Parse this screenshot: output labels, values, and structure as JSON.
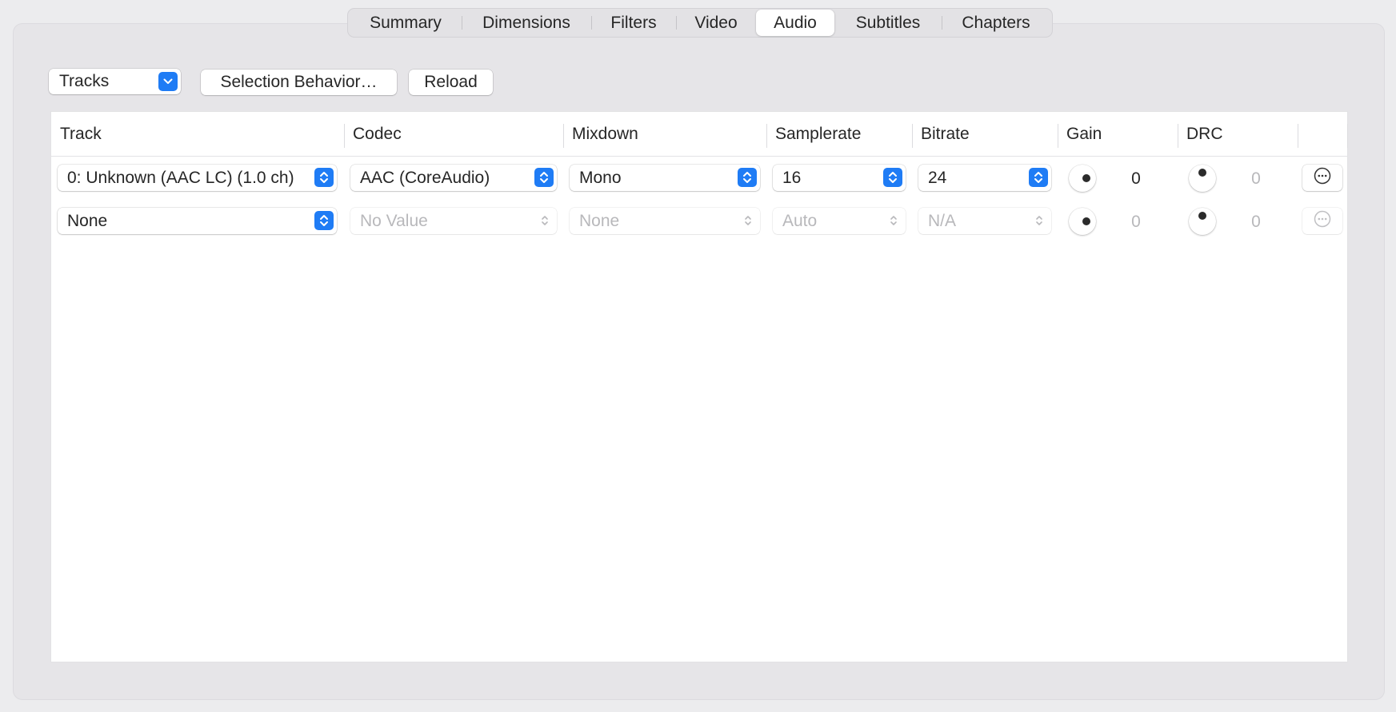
{
  "tabs": [
    {
      "label": "Summary",
      "active": false
    },
    {
      "label": "Dimensions",
      "active": false
    },
    {
      "label": "Filters",
      "active": false
    },
    {
      "label": "Video",
      "active": false
    },
    {
      "label": "Audio",
      "active": true
    },
    {
      "label": "Subtitles",
      "active": false
    },
    {
      "label": "Chapters",
      "active": false
    }
  ],
  "toolbar": {
    "tracks_popup": "Tracks",
    "selection_behavior_label": "Selection Behavior…",
    "reload_label": "Reload"
  },
  "table": {
    "columns": [
      "Track",
      "Codec",
      "Mixdown",
      "Samplerate",
      "Bitrate",
      "Gain",
      "DRC"
    ],
    "rows": [
      {
        "track": "0: Unknown (AAC LC) (1.0 ch)",
        "codec": "AAC (CoreAudio)",
        "mixdown": "Mono",
        "samplerate": "16",
        "bitrate": "24",
        "gain": "0",
        "drc": "0",
        "enabled": true
      },
      {
        "track": "None",
        "codec": "No Value",
        "mixdown": "None",
        "samplerate": "Auto",
        "bitrate": "N/A",
        "gain": "0",
        "drc": "0",
        "enabled": false
      }
    ]
  },
  "colors": {
    "accent": "#1f7cf5",
    "background": "#ececee",
    "disabled_text": "#b8b8bb"
  },
  "icons": {
    "popup_chevron": "up-down-chevron-icon",
    "more": "ellipsis-circle-icon"
  }
}
